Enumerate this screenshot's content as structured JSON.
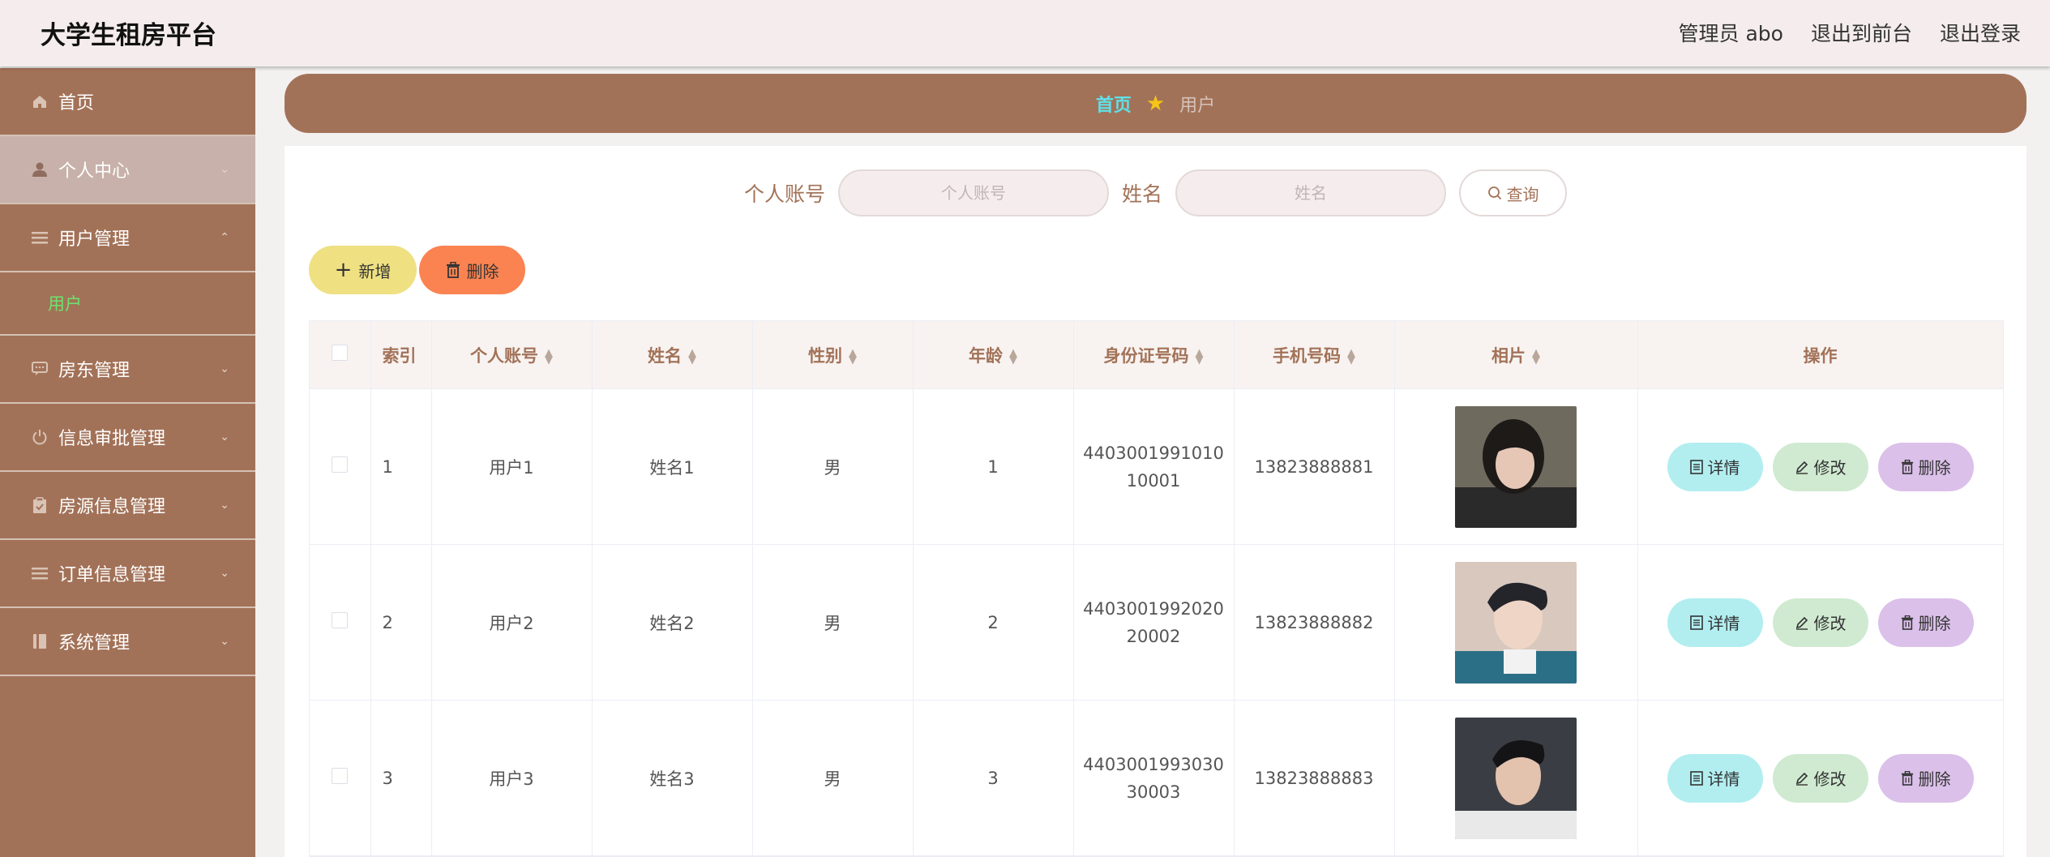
{
  "header": {
    "app_title": "大学生租房平台",
    "admin_label": "管理员 abo",
    "back_to_front": "退出到前台",
    "logout": "退出登录"
  },
  "sidebar": {
    "items": [
      {
        "label": "首页",
        "icon": "home-icon"
      },
      {
        "label": "个人中心",
        "icon": "user-icon",
        "active": true
      },
      {
        "label": "用户管理",
        "icon": "list-icon",
        "expanded": true,
        "sub": [
          {
            "label": "用户"
          }
        ]
      },
      {
        "label": "房东管理",
        "icon": "chat-icon"
      },
      {
        "label": "信息审批管理",
        "icon": "power-icon"
      },
      {
        "label": "房源信息管理",
        "icon": "clipboard-icon"
      },
      {
        "label": "订单信息管理",
        "icon": "list-icon"
      },
      {
        "label": "系统管理",
        "icon": "book-icon"
      }
    ]
  },
  "breadcrumb": {
    "home": "首页",
    "current": "用户"
  },
  "search": {
    "account_label": "个人账号",
    "account_placeholder": "个人账号",
    "name_label": "姓名",
    "name_placeholder": "姓名",
    "query_label": "查询"
  },
  "actions": {
    "add_label": "新增",
    "delete_label": "删除"
  },
  "table": {
    "headers": [
      "索引",
      "个人账号",
      "姓名",
      "性别",
      "年龄",
      "身份证号码",
      "手机号码",
      "相片",
      "操作"
    ],
    "rows": [
      {
        "index": "1",
        "account": "用户1",
        "name": "姓名1",
        "gender": "男",
        "age": "1",
        "id_line1": "4403001991010",
        "id_line2": "10001",
        "phone": "13823888881"
      },
      {
        "index": "2",
        "account": "用户2",
        "name": "姓名2",
        "gender": "男",
        "age": "2",
        "id_line1": "4403001992020",
        "id_line2": "20002",
        "phone": "13823888882"
      },
      {
        "index": "3",
        "account": "用户3",
        "name": "姓名3",
        "gender": "男",
        "age": "3",
        "id_line1": "4403001993030",
        "id_line2": "30003",
        "phone": "13823888883"
      }
    ],
    "row_actions": {
      "detail": "详情",
      "edit": "修改",
      "delete": "删除"
    }
  },
  "colors": {
    "brand": "#a27258",
    "accent_cyan": "#5fe0e8",
    "sub_active": "#6ee36e"
  }
}
